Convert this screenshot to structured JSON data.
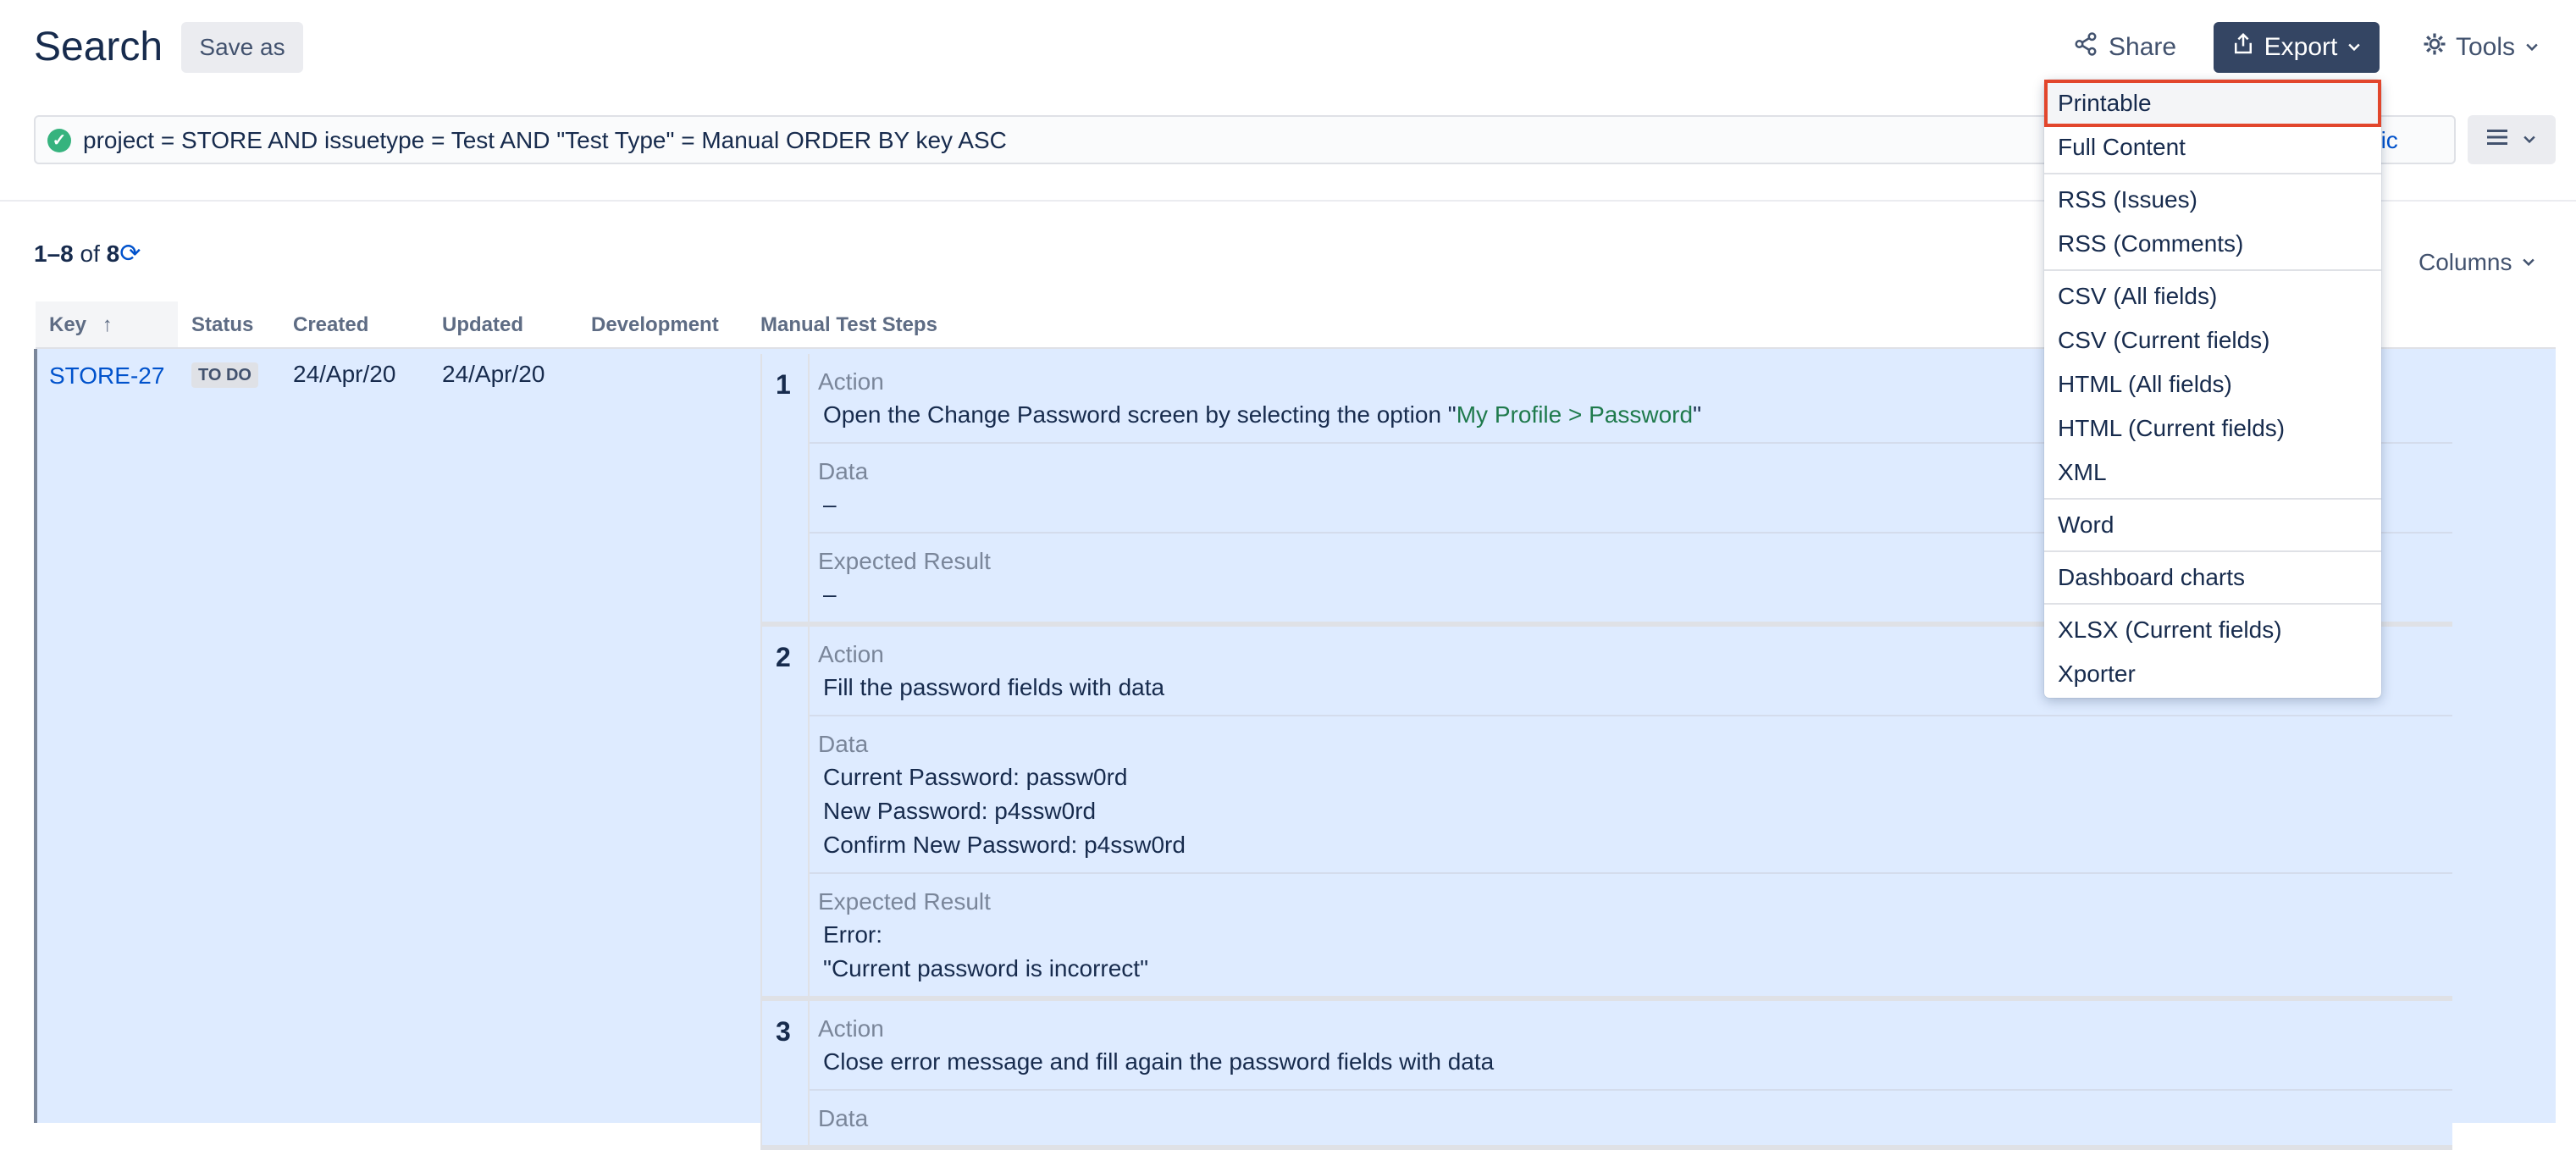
{
  "header": {
    "title": "Search",
    "save_as": "Save as",
    "share": "Share",
    "export": "Export",
    "tools": "Tools"
  },
  "jql": {
    "query": "project = STORE AND issuetype = Test AND \"Test Type\" = Manual ORDER BY key ASC",
    "switch_label_visible": "asic"
  },
  "results": {
    "range": "1–8",
    "of": "of",
    "total": "8",
    "columns_button": "Columns"
  },
  "table": {
    "headers": [
      "Key",
      "Status",
      "Created",
      "Updated",
      "Development",
      "Manual Test Steps"
    ],
    "sort_indicator": "↑"
  },
  "issue": {
    "key": "STORE-27",
    "status": "TO DO",
    "created": "24/Apr/20",
    "updated": "24/Apr/20",
    "steps": [
      {
        "num": "1",
        "action_label": "Action",
        "action_prefix": "Open the Change Password screen by selecting the option \"",
        "action_highlight": "My Profile > Password",
        "action_suffix": "\"",
        "data_label": "Data",
        "data": "–",
        "expected_label": "Expected Result",
        "expected": "–"
      },
      {
        "num": "2",
        "action_label": "Action",
        "action": "Fill the password fields with data",
        "data_label": "Data",
        "data": "Current Password: passw0rd\nNew Password: p4ssw0rd\nConfirm New Password: p4ssw0rd",
        "expected_label": "Expected Result",
        "expected": "Error:\n\"Current password is incorrect\""
      },
      {
        "num": "3",
        "action_label": "Action",
        "action": "Close error message and fill again the password fields with data",
        "data_label": "Data"
      }
    ]
  },
  "export_menu": {
    "items": [
      "Printable",
      "Full Content",
      "RSS (Issues)",
      "RSS (Comments)",
      "CSV (All fields)",
      "CSV (Current fields)",
      "HTML (All fields)",
      "HTML (Current fields)",
      "XML",
      "Word",
      "Dashboard charts",
      "XLSX (Current fields)",
      "Xporter"
    ],
    "highlighted": "Printable"
  },
  "colors": {
    "brand_dark": "#344563",
    "link": "#0052cc",
    "selected_row": "#deebff",
    "highlight_border": "#e2462c",
    "success": "#36b37e"
  },
  "icons": [
    "share-icon",
    "export-icon",
    "chevron-down-icon",
    "gear-icon",
    "check-circle-icon",
    "list-view-icon",
    "refresh-icon",
    "sort-asc-icon"
  ]
}
